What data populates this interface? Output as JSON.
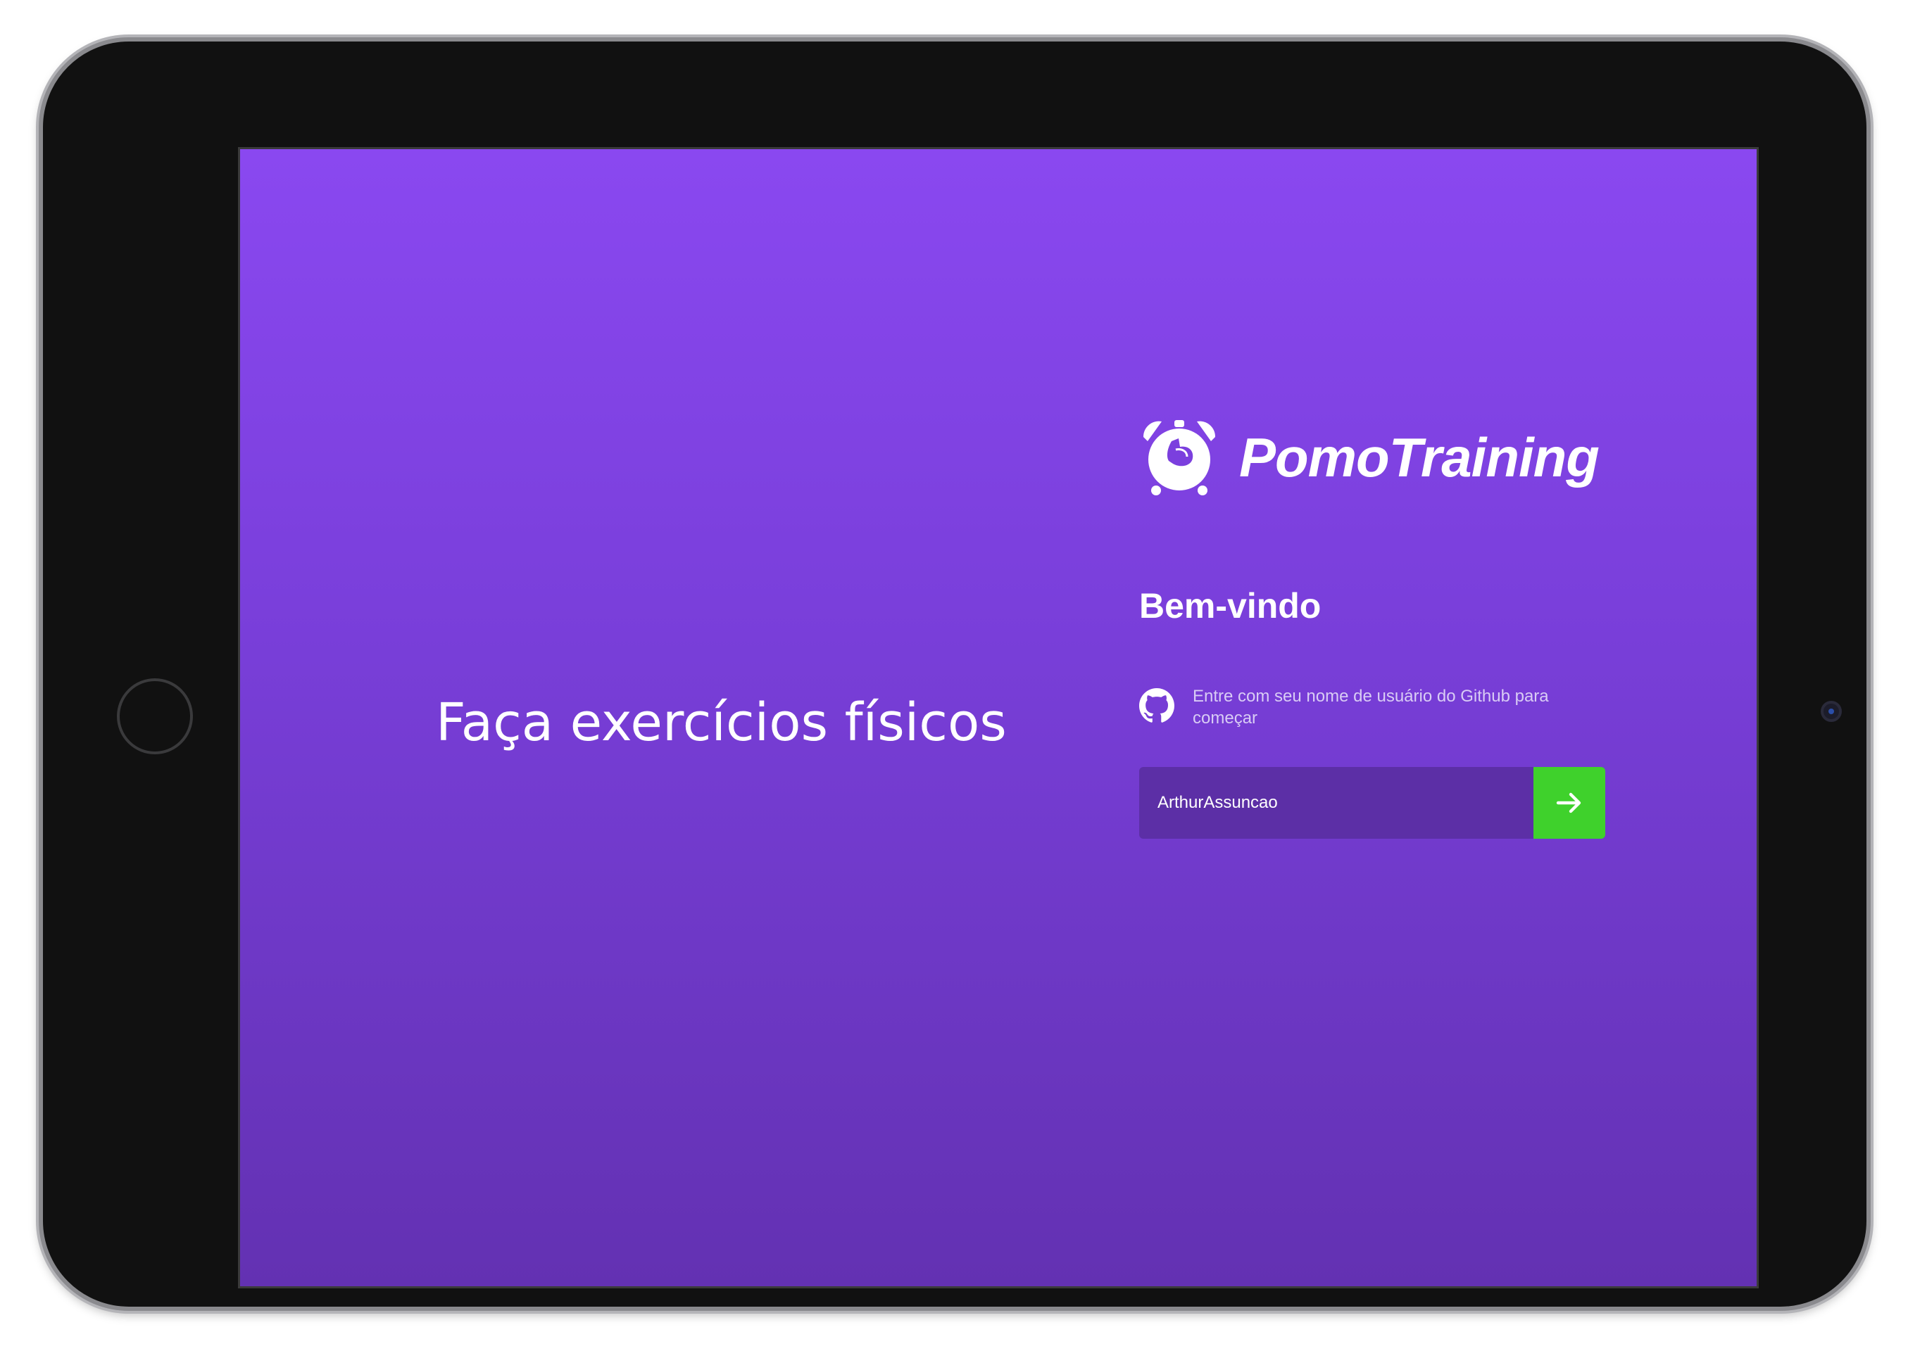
{
  "tagline": "Faça exercícios físicos",
  "brand": {
    "name": "PomoTraining",
    "logo_icon": "alarm-clock-flexed-arm-icon"
  },
  "login": {
    "heading": "Bem-vindo",
    "github_hint": "Entre com seu nome de usuário do Github para começar",
    "github_icon": "github-icon",
    "username_value": "ArthurAssuncao",
    "submit_icon": "arrow-right-icon"
  },
  "colors": {
    "background_top": "#8a48f0",
    "background_bottom": "#6331b2",
    "input_background": "#5c2fa6",
    "submit_green": "#3fd12c",
    "text": "#ffffff"
  }
}
